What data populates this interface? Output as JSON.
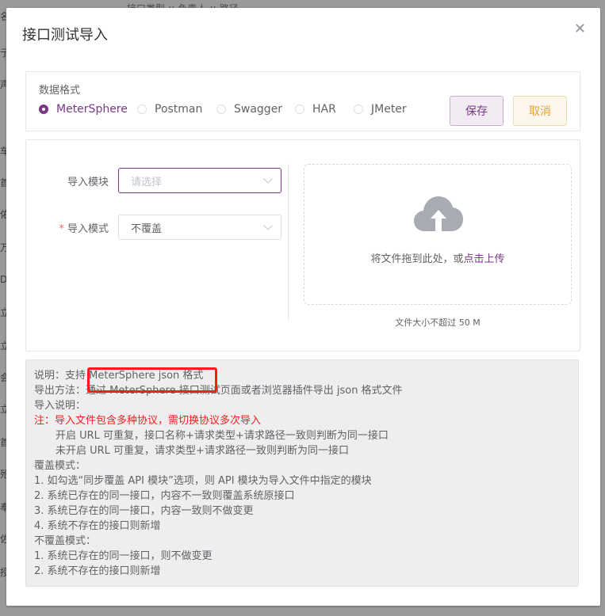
{
  "background": {
    "top_fragments": "接口类型  ∨     负责人  ∨     路径",
    "left_chars": [
      "名",
      "亍",
      "声",
      "",
      "车",
      "首",
      "佑",
      "万",
      "D",
      "立",
      "立",
      "会",
      "立",
      "首",
      "殆",
      "奉",
      "佐",
      "授"
    ]
  },
  "dialog": {
    "title": "接口测试导入",
    "close_icon": "close-icon"
  },
  "format": {
    "label": "数据格式",
    "options": [
      "MeterSphere",
      "Postman",
      "Swagger",
      "HAR",
      "JMeter"
    ],
    "selected": "MeterSphere",
    "save_label": "保存",
    "cancel_label": "取消"
  },
  "form": {
    "module_label": "导入模块",
    "module_placeholder": "请选择",
    "mode_required_mark": "*",
    "mode_label": "导入模式",
    "mode_value": "不覆盖"
  },
  "upload": {
    "icon": "cloud-upload-icon",
    "text_before": "将文件拖到此处，或",
    "link_text": "点击上传",
    "tip": "文件大小不超过 50 M"
  },
  "description": {
    "line1": "说明：支持 MeterSphere json 格式",
    "line2": "导出方法：通过 MeterSphere 接口测试页面或者浏览器插件导出 json 格式文件",
    "line3": "导入说明：",
    "line4": "注：导入文件包含多种协议，需切换协议多次导入",
    "line5": "开启 URL 可重复，接口名称+请求类型+请求路径一致则判断为同一接口",
    "line6": "未开启 URL 可重复，请求类型+请求路径一致则判断为同一接口",
    "line7": "覆盖模式：",
    "line8": "1. 如勾选“同步覆盖 API 模块”选项，则 API 模块为导入文件中指定的模块",
    "line9": "2. 系统已存在的同一接口，内容不一致则覆盖系统原接口",
    "line10": "3. 系统已存在的同一接口，内容一致则不做变更",
    "line11": "4. 系统不存在的接口则新增",
    "line12": "不覆盖模式：",
    "line13": "1. 系统已存在的同一接口，则不做变更",
    "line14": "2. 系统不存在的接口则新增"
  },
  "colors": {
    "accent": "#783887",
    "warning": "#e6a23c",
    "danger": "#f01f1f",
    "highlight_box": "#ff1a1a"
  }
}
